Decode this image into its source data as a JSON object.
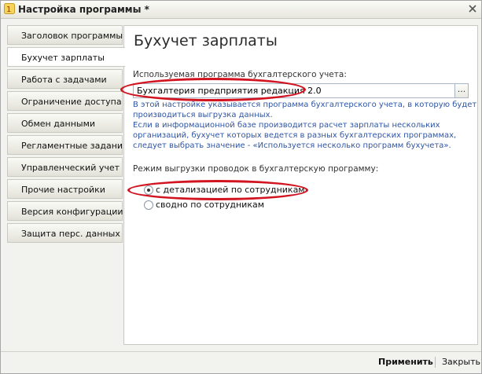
{
  "window": {
    "title": "Настройка программы *"
  },
  "nav": {
    "items": [
      {
        "label": "Заголовок программы"
      },
      {
        "label": "Бухучет зарплаты"
      },
      {
        "label": "Работа с задачами"
      },
      {
        "label": "Ограничение доступа"
      },
      {
        "label": "Обмен данными"
      },
      {
        "label": "Регламентные задания"
      },
      {
        "label": "Управленческий учет"
      },
      {
        "label": "Прочие настройки"
      },
      {
        "label": "Версия конфигурации"
      },
      {
        "label": "Защита перс. данных"
      }
    ],
    "active_index": 1
  },
  "panel": {
    "title": "Бухучет зарплаты",
    "program_label": "Используемая программа бухгалтерского учета:",
    "program_value": "Бухгалтерия предприятия редакция 2.0",
    "select_button": "...",
    "hint_lines": [
      "В этой настройке указывается программа бухгалтерского учета, в которую будет",
      "производиться выгрузка данных.",
      "Если в информационной базе производится расчет зарплаты нескольких",
      "организаций, бухучет которых ведется в разных бухгалтерских программах,",
      "следует выбрать значение - «Используется несколько программ бухучета»."
    ],
    "export_mode_label": "Режим выгрузки проводок в бухгалтерскую программу:",
    "radio_options": [
      {
        "label": "с детализацией по сотрудникам",
        "selected": true
      },
      {
        "label": "сводно по сотрудникам",
        "selected": false
      }
    ]
  },
  "footer": {
    "apply_label": "Применить",
    "close_label": "Закрыть"
  },
  "colors": {
    "annotation_red": "#d11420",
    "hint_blue": "#2f55a4"
  }
}
